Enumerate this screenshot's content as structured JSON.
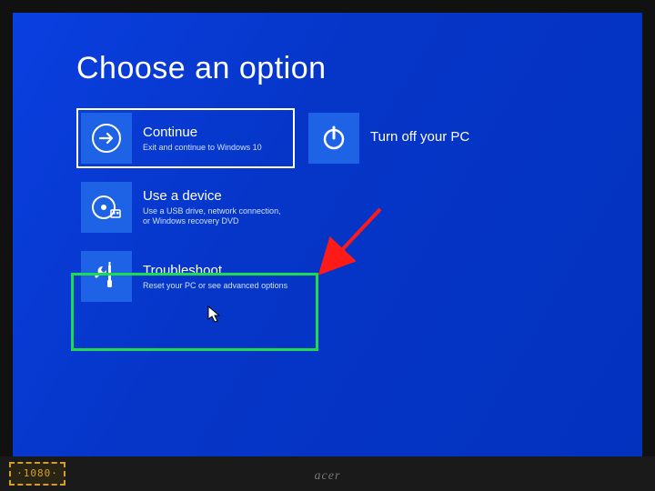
{
  "page_title": "Choose an option",
  "tiles": {
    "continue": {
      "title": "Continue",
      "desc": "Exit and continue to Windows 10"
    },
    "turnoff": {
      "title": "Turn off your PC",
      "desc": ""
    },
    "device": {
      "title": "Use a device",
      "desc": "Use a USB drive, network connection, or Windows recovery DVD"
    },
    "troubleshoot": {
      "title": "Troubleshoot",
      "desc": "Reset your PC or see advanced options"
    }
  },
  "hardware": {
    "brand": "acer",
    "sticker": "·1080·"
  }
}
